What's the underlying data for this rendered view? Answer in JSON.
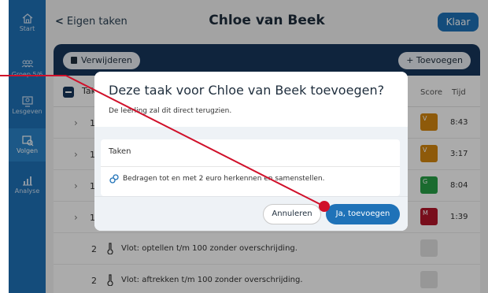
{
  "sidebar": {
    "items": [
      {
        "label": "Start",
        "icon": "home-icon"
      },
      {
        "label": "Groep 5/6",
        "icon": "group-icon"
      },
      {
        "label": "Lesgeven",
        "icon": "teach-icon"
      },
      {
        "label": "Volgen",
        "icon": "track-icon",
        "active": true
      },
      {
        "label": "Analyse",
        "icon": "chart-icon"
      }
    ]
  },
  "header": {
    "back_label": "Eigen taken",
    "title": "Chloe van Beek",
    "done_label": "Klaar"
  },
  "toolbar": {
    "delete_label": "Verwijderen",
    "add_label": "+ Toevoegen"
  },
  "table": {
    "header_task": "Tak",
    "header_score": "Score",
    "header_time": "Tijd",
    "rows": [
      {
        "num": "1",
        "text": "",
        "score": "V",
        "score_color": "#d4860f",
        "time": "8:43"
      },
      {
        "num": "1",
        "text": "",
        "score": "V",
        "score_color": "#d4860f",
        "time": "3:17"
      },
      {
        "num": "1",
        "text": "",
        "score": "G",
        "score_color": "#27a046",
        "time": "8:04"
      },
      {
        "num": "1",
        "text": "",
        "score": "M",
        "score_color": "#b3162a",
        "time": "1:39"
      },
      {
        "num": "2",
        "text": "Vlot: optellen t/m 100 zonder overschrijding.",
        "score": "",
        "score_color": "",
        "time": ""
      },
      {
        "num": "2",
        "text": "Vlot: aftrekken t/m 100 zonder overschrijding.",
        "score": "",
        "score_color": "",
        "time": ""
      }
    ]
  },
  "dialog": {
    "title": "Deze taak voor Chloe van Beek toevoegen?",
    "message": "De leerling zal dit direct terugzien.",
    "tasks_label": "Taken",
    "task_item": "Bedragen tot en met 2 euro herkennen en samenstellen.",
    "cancel_label": "Annuleren",
    "confirm_label": "Ja, toevoegen"
  },
  "colors": {
    "accent": "#1f72b8",
    "toolbar": "#17365c",
    "annotation": "#d0102a"
  }
}
